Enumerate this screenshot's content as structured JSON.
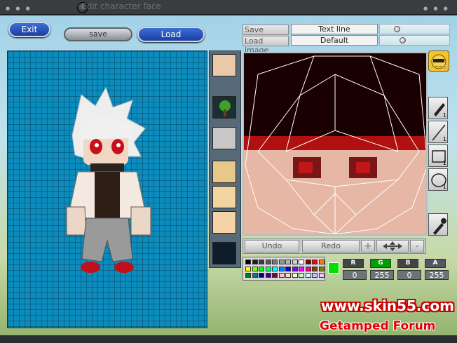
{
  "window": {
    "title": "Edit character face"
  },
  "buttons": {
    "exit": "Exit",
    "save": "save",
    "load": "Load"
  },
  "image_fields": {
    "save_image": "Save image",
    "load_image": "Load image",
    "text_line": "Text line",
    "default": "Default"
  },
  "player_badge": {
    "count": "1"
  },
  "tools": [
    {
      "name": "pen",
      "count": "1"
    },
    {
      "name": "line",
      "count": "1"
    },
    {
      "name": "rectangle",
      "count": "1"
    },
    {
      "name": "ellipse",
      "count": "1"
    },
    {
      "name": "eyedropper",
      "count": ""
    }
  ],
  "controls": {
    "undo": "Undo",
    "redo": "Redo"
  },
  "current_color": "#00e000",
  "channels": [
    {
      "label": "R",
      "value": "0",
      "color": "#444"
    },
    {
      "label": "G",
      "value": "255",
      "color": "#00a000"
    },
    {
      "label": "B",
      "value": "0",
      "color": "#444"
    },
    {
      "label": "A",
      "value": "255",
      "color": "#556"
    }
  ],
  "watermark": {
    "site": "www.skin55.com",
    "forum": "Getamped Forum"
  },
  "palette": [
    "#000000",
    "#1e1e1e",
    "#3c3c3c",
    "#5a5a5a",
    "#787878",
    "#969696",
    "#b4b4b4",
    "#d2d2d2",
    "#ffffff",
    "#800000",
    "#ff0000",
    "#ff8000",
    "#ffff00",
    "#80ff00",
    "#00ff00",
    "#00ff80",
    "#00ffff",
    "#0080ff",
    "#0000ff",
    "#8000ff",
    "#ff00ff",
    "#ff0080",
    "#804000",
    "#808000",
    "#008000",
    "#008080",
    "#000080",
    "#400080",
    "#800040",
    "#ffc0c0",
    "#ffe0c0",
    "#ffffc0",
    "#c0ffc0",
    "#c0ffff",
    "#c0c0ff",
    "#ffc0ff"
  ]
}
